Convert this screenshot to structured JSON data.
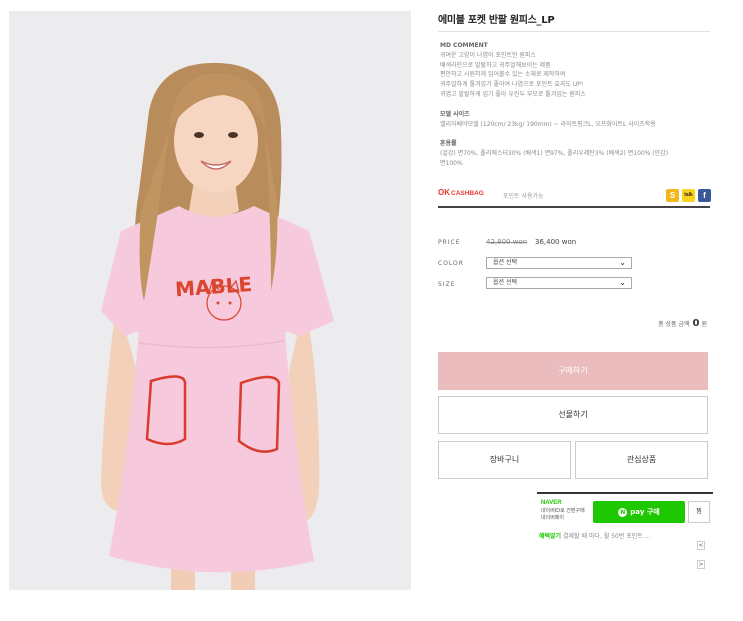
{
  "product": {
    "title": "에미블 포켓 반팔 원피스_LP",
    "image_alt_text": "MABLE"
  },
  "md": {
    "heading": "MD COMMENT",
    "lines": [
      "귀여운 고양이 나염이 포인트인 원피스",
      "배색라인으로 발랄하고 귀주얼해보이는 제품",
      "편안하고 시원하게 입어볼수 있는 소재로 제작하여",
      "귀주얼하게 툴겨입기 좋아여 나염으로 포인트 효과도 UP!",
      "귀엽고 발랄하게 입기 좋아 우린두 부모로 툴겨입는 원피스"
    ],
    "size_heading": "모델 사이즈",
    "size_line": "앨리자베야모델 (120cm/ 23kg/ 190mm) ~ 라이트핑크L, 오프화이트L 사이즈착용",
    "material_heading": "혼용률",
    "material_lines": [
      "(겉감) 면70%, 폴리에스터30% (배색1) 면97%, 폴리우레탄3% (배색2) 면100% (안감)",
      "면100%"
    ]
  },
  "okcashbag": {
    "logo_ok": "OK",
    "logo_cashbag": "CASHBAG",
    "text": "포인트 사용가능"
  },
  "share": {
    "kakaostory": "S",
    "kakaotalk": "talk",
    "facebook": "f"
  },
  "options": {
    "price_label": "PRICE",
    "price_old": "42,800 won",
    "price_new": "36,400 won",
    "color_label": "COLOR",
    "color_value": "옵션 선택",
    "size_label": "SIZE",
    "size_value": "옵션 선택"
  },
  "total": {
    "label": "총 상품 금액",
    "value": "0",
    "unit": "원"
  },
  "buttons": {
    "buy": "구매하기",
    "gift": "선물하기",
    "cart": "장바구니",
    "wish": "관심상품"
  },
  "npay": {
    "brand": "NAVER",
    "sub1": "네이버ID로 간편구매",
    "sub2": "네이버페이",
    "button_n": "N",
    "button_label": "pay 구매",
    "wish_label": "찜",
    "event_label": "혜택알기",
    "event_text": "결제할 때 마다, 월 50번 포인트 …",
    "prev": "<",
    "next": ">"
  },
  "colors": {
    "buy_button": "#ebbcbe",
    "npay_green": "#1ec800",
    "okcashbag_red": "#e8382f",
    "dress_pink": "#f6c9dd",
    "print_red": "#d9452d"
  }
}
